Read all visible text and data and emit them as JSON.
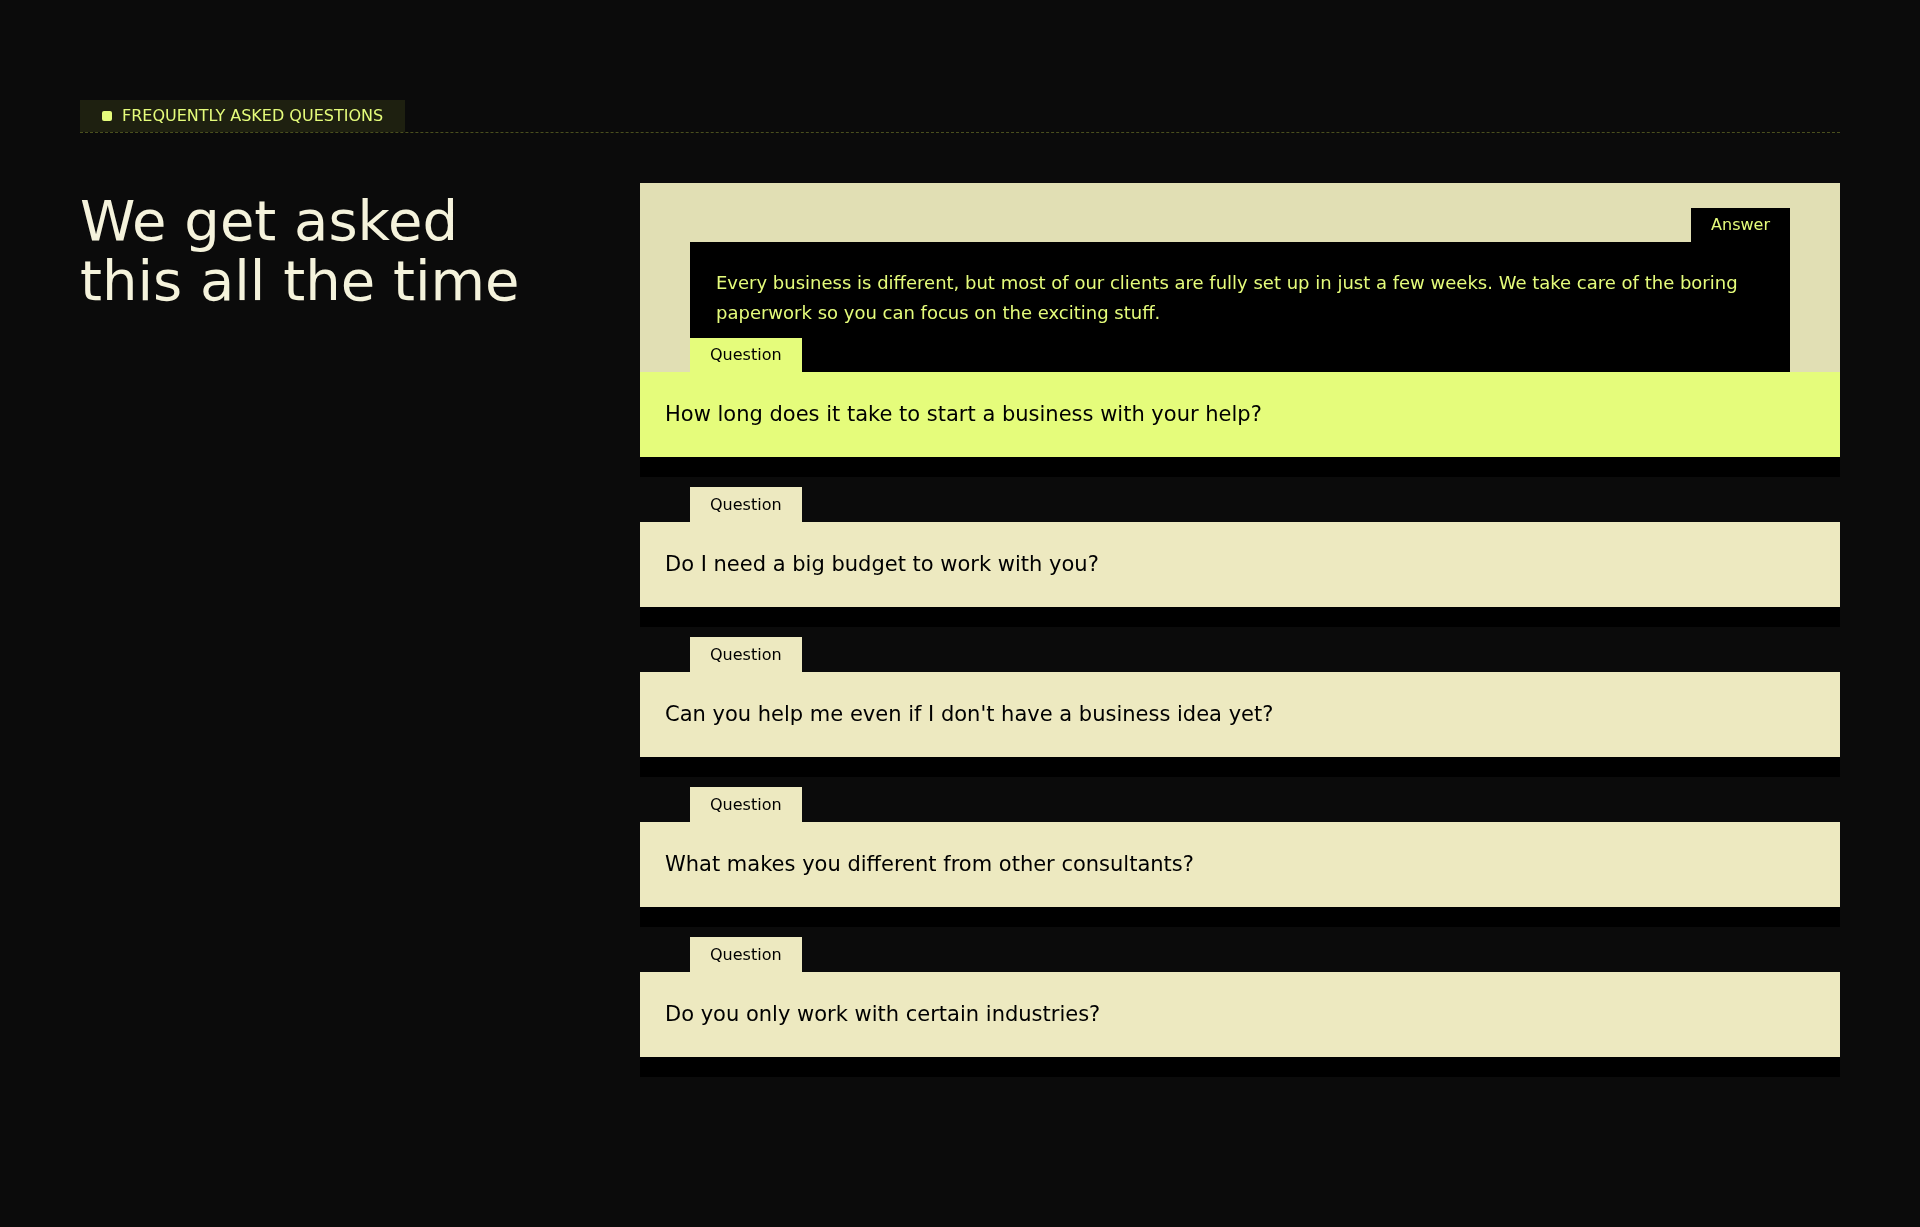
{
  "section_label": "FREQUENTLY ASKED QUESTIONS",
  "heading": "We get asked this all the time",
  "faqs": [
    {
      "expanded": true,
      "answer_tab": "Answer",
      "answer": "Every business is different, but most of our clients are fully set up in just a few weeks. We take care of the boring paperwork so you can focus on the exciting stuff.",
      "question_tab": "Question",
      "question": "How long does it take to start a business with your help?"
    },
    {
      "expanded": false,
      "question_tab": "Question",
      "question": "Do I need a big budget to work with you?"
    },
    {
      "expanded": false,
      "question_tab": "Question",
      "question": "Can you help me even if I don't have a business idea yet?"
    },
    {
      "expanded": false,
      "question_tab": "Question",
      "question": "What makes you different from other consultants?"
    },
    {
      "expanded": false,
      "question_tab": "Question",
      "question": "Do you only work with certain industries?"
    }
  ]
}
